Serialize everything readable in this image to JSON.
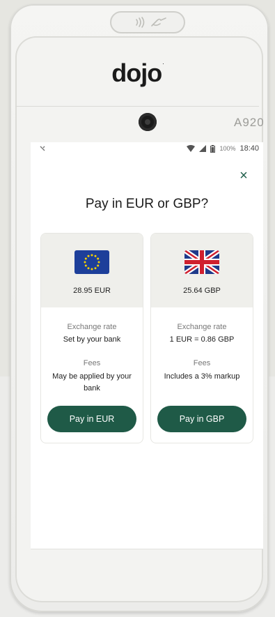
{
  "device": {
    "brand": "dojo",
    "brand_mark": ".",
    "model": "A920"
  },
  "statusbar": {
    "left_icon": "x-icon",
    "battery_pct": "100%",
    "time": "18:40"
  },
  "dialog": {
    "close_symbol": "×",
    "title": "Pay in EUR or GBP?"
  },
  "options": [
    {
      "flag": "eu-flag-icon",
      "amount": "28.95 EUR",
      "rate_label": "Exchange rate",
      "rate_value": "Set by your bank",
      "fees_label": "Fees",
      "fees_value": "May be applied by your bank",
      "button_label": "Pay in EUR"
    },
    {
      "flag": "uk-flag-icon",
      "amount": "25.64 GBP",
      "rate_label": "Exchange rate",
      "rate_value": "1 EUR = 0.86 GBP",
      "fees_label": "Fees",
      "fees_value": "Includes a 3% markup",
      "button_label": "Pay in GBP"
    }
  ],
  "colors": {
    "accent": "#1f5a47",
    "card_header": "#efefeb"
  }
}
